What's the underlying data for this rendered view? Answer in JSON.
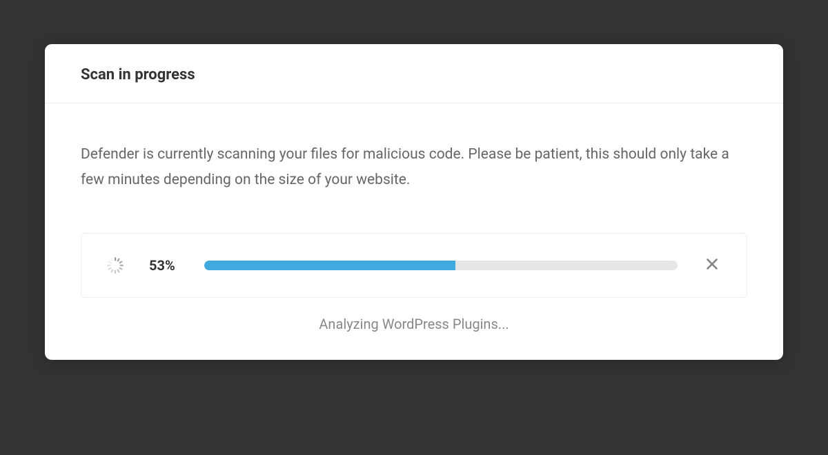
{
  "header": {
    "title": "Scan in progress"
  },
  "body": {
    "description": "Defender is currently scanning your files for malicious code. Please be patient, this should only take a few minutes depending on the size of your website."
  },
  "progress": {
    "percent_value": 53,
    "percent_label": "53%",
    "status": "Analyzing WordPress Plugins..."
  },
  "colors": {
    "accent": "#3fa9e0",
    "track": "#e6e6e6",
    "text_muted": "#888888"
  }
}
